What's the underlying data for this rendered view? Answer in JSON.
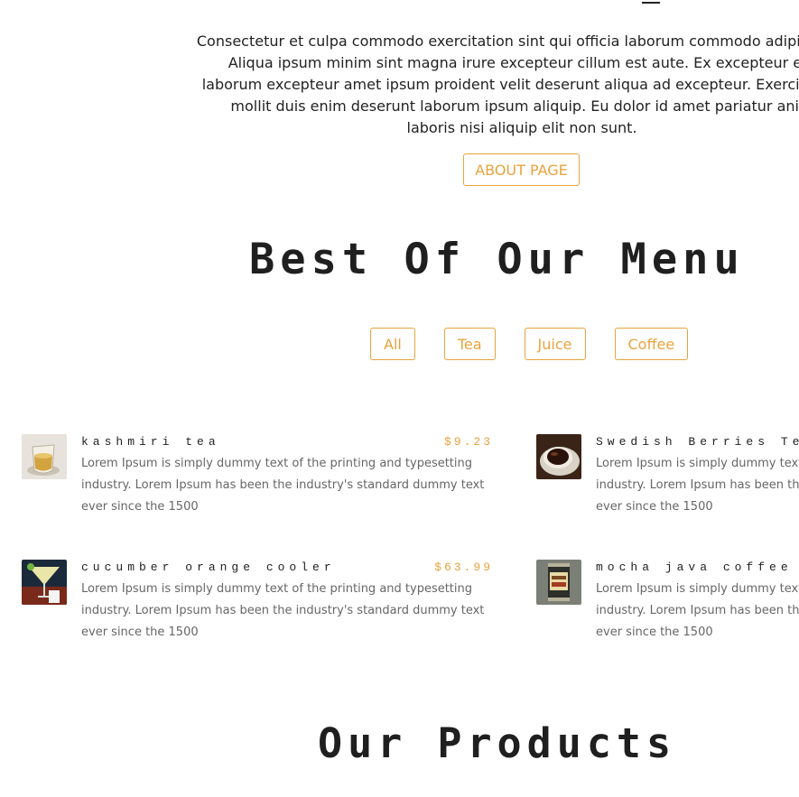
{
  "about": {
    "lines": [
      "Consectetur et culpa commodo exercitation sint qui officia laborum commodo adipisicing.",
      "Aliqua ipsum minim sint magna irure excepteur cillum est aute. Ex excepteur elit",
      "laborum excepteur amet ipsum proident velit deserunt aliqua ad excepteur. Exercitation",
      "mollit duis enim deserunt laborum ipsum aliquip. Eu dolor id amet pariatur anim",
      "laboris nisi aliquip elit non sunt."
    ],
    "button_label": "ABOUT PAGE"
  },
  "menu": {
    "title": "Best Of Our Menu",
    "filters": [
      "All",
      "Tea",
      "Juice",
      "Coffee"
    ],
    "items": [
      {
        "name": "kashmiri tea",
        "price": "$9.23",
        "desc_lines": [
          "Lorem Ipsum is simply dummy text of the printing and typesetting",
          "industry. Lorem Ipsum has been the industry's standard dummy text",
          "ever since the 1500"
        ]
      },
      {
        "name": "Swedish Berries Tea",
        "price": "",
        "desc_lines": [
          "Lorem Ipsum is simply dummy text of the printing and typesetting",
          "industry. Lorem Ipsum has been the industry's standard dummy text",
          "ever since the 1500"
        ]
      },
      {
        "name": "cucumber orange cooler",
        "price": "$63.99",
        "desc_lines": [
          "Lorem Ipsum is simply dummy text of the printing and typesetting",
          "industry. Lorem Ipsum has been the industry's standard dummy text",
          "ever since the 1500"
        ]
      },
      {
        "name": "mocha java coffee",
        "price": "",
        "desc_lines": [
          "Lorem Ipsum is simply dummy text of the printing and typesetting",
          "industry. Lorem Ipsum has been the industry's standard dummy text",
          "ever since the 1500"
        ]
      }
    ]
  },
  "products": {
    "title": "Our Products"
  },
  "colors": {
    "accent": "#e8a33d",
    "text": "#222222",
    "muted": "#666666"
  }
}
